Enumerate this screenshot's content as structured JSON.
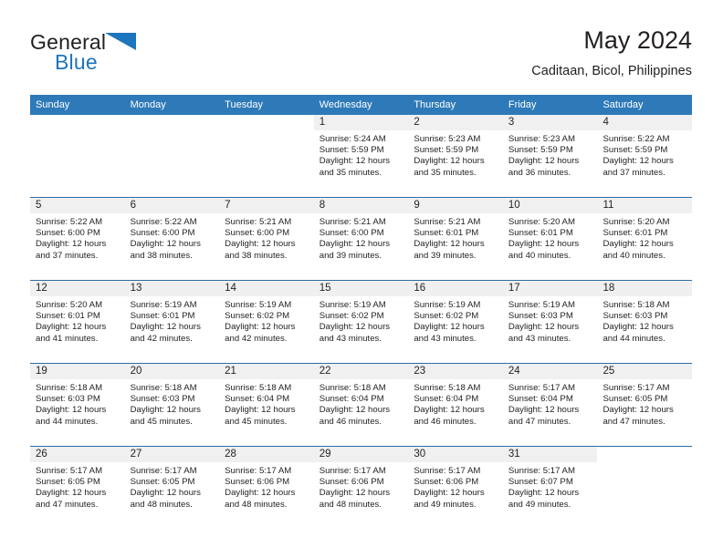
{
  "brand": {
    "name_part1": "General",
    "name_part2": "Blue",
    "accent_color": "#1d75bd"
  },
  "header": {
    "title": "May 2024",
    "subtitle": "Caditaan, Bicol, Philippines"
  },
  "calendar": {
    "header_color": "#2e7ab8",
    "weekdays": [
      "Sunday",
      "Monday",
      "Tuesday",
      "Wednesday",
      "Thursday",
      "Friday",
      "Saturday"
    ],
    "weeks": [
      [
        {
          "day": "",
          "sunrise": "",
          "sunset": "",
          "daylight": "",
          "daylight2": ""
        },
        {
          "day": "",
          "sunrise": "",
          "sunset": "",
          "daylight": "",
          "daylight2": ""
        },
        {
          "day": "",
          "sunrise": "",
          "sunset": "",
          "daylight": "",
          "daylight2": ""
        },
        {
          "day": "1",
          "sunrise": "Sunrise: 5:24 AM",
          "sunset": "Sunset: 5:59 PM",
          "daylight": "Daylight: 12 hours",
          "daylight2": "and 35 minutes."
        },
        {
          "day": "2",
          "sunrise": "Sunrise: 5:23 AM",
          "sunset": "Sunset: 5:59 PM",
          "daylight": "Daylight: 12 hours",
          "daylight2": "and 35 minutes."
        },
        {
          "day": "3",
          "sunrise": "Sunrise: 5:23 AM",
          "sunset": "Sunset: 5:59 PM",
          "daylight": "Daylight: 12 hours",
          "daylight2": "and 36 minutes."
        },
        {
          "day": "4",
          "sunrise": "Sunrise: 5:22 AM",
          "sunset": "Sunset: 5:59 PM",
          "daylight": "Daylight: 12 hours",
          "daylight2": "and 37 minutes."
        }
      ],
      [
        {
          "day": "5",
          "sunrise": "Sunrise: 5:22 AM",
          "sunset": "Sunset: 6:00 PM",
          "daylight": "Daylight: 12 hours",
          "daylight2": "and 37 minutes."
        },
        {
          "day": "6",
          "sunrise": "Sunrise: 5:22 AM",
          "sunset": "Sunset: 6:00 PM",
          "daylight": "Daylight: 12 hours",
          "daylight2": "and 38 minutes."
        },
        {
          "day": "7",
          "sunrise": "Sunrise: 5:21 AM",
          "sunset": "Sunset: 6:00 PM",
          "daylight": "Daylight: 12 hours",
          "daylight2": "and 38 minutes."
        },
        {
          "day": "8",
          "sunrise": "Sunrise: 5:21 AM",
          "sunset": "Sunset: 6:00 PM",
          "daylight": "Daylight: 12 hours",
          "daylight2": "and 39 minutes."
        },
        {
          "day": "9",
          "sunrise": "Sunrise: 5:21 AM",
          "sunset": "Sunset: 6:01 PM",
          "daylight": "Daylight: 12 hours",
          "daylight2": "and 39 minutes."
        },
        {
          "day": "10",
          "sunrise": "Sunrise: 5:20 AM",
          "sunset": "Sunset: 6:01 PM",
          "daylight": "Daylight: 12 hours",
          "daylight2": "and 40 minutes."
        },
        {
          "day": "11",
          "sunrise": "Sunrise: 5:20 AM",
          "sunset": "Sunset: 6:01 PM",
          "daylight": "Daylight: 12 hours",
          "daylight2": "and 40 minutes."
        }
      ],
      [
        {
          "day": "12",
          "sunrise": "Sunrise: 5:20 AM",
          "sunset": "Sunset: 6:01 PM",
          "daylight": "Daylight: 12 hours",
          "daylight2": "and 41 minutes."
        },
        {
          "day": "13",
          "sunrise": "Sunrise: 5:19 AM",
          "sunset": "Sunset: 6:01 PM",
          "daylight": "Daylight: 12 hours",
          "daylight2": "and 42 minutes."
        },
        {
          "day": "14",
          "sunrise": "Sunrise: 5:19 AM",
          "sunset": "Sunset: 6:02 PM",
          "daylight": "Daylight: 12 hours",
          "daylight2": "and 42 minutes."
        },
        {
          "day": "15",
          "sunrise": "Sunrise: 5:19 AM",
          "sunset": "Sunset: 6:02 PM",
          "daylight": "Daylight: 12 hours",
          "daylight2": "and 43 minutes."
        },
        {
          "day": "16",
          "sunrise": "Sunrise: 5:19 AM",
          "sunset": "Sunset: 6:02 PM",
          "daylight": "Daylight: 12 hours",
          "daylight2": "and 43 minutes."
        },
        {
          "day": "17",
          "sunrise": "Sunrise: 5:19 AM",
          "sunset": "Sunset: 6:03 PM",
          "daylight": "Daylight: 12 hours",
          "daylight2": "and 43 minutes."
        },
        {
          "day": "18",
          "sunrise": "Sunrise: 5:18 AM",
          "sunset": "Sunset: 6:03 PM",
          "daylight": "Daylight: 12 hours",
          "daylight2": "and 44 minutes."
        }
      ],
      [
        {
          "day": "19",
          "sunrise": "Sunrise: 5:18 AM",
          "sunset": "Sunset: 6:03 PM",
          "daylight": "Daylight: 12 hours",
          "daylight2": "and 44 minutes."
        },
        {
          "day": "20",
          "sunrise": "Sunrise: 5:18 AM",
          "sunset": "Sunset: 6:03 PM",
          "daylight": "Daylight: 12 hours",
          "daylight2": "and 45 minutes."
        },
        {
          "day": "21",
          "sunrise": "Sunrise: 5:18 AM",
          "sunset": "Sunset: 6:04 PM",
          "daylight": "Daylight: 12 hours",
          "daylight2": "and 45 minutes."
        },
        {
          "day": "22",
          "sunrise": "Sunrise: 5:18 AM",
          "sunset": "Sunset: 6:04 PM",
          "daylight": "Daylight: 12 hours",
          "daylight2": "and 46 minutes."
        },
        {
          "day": "23",
          "sunrise": "Sunrise: 5:18 AM",
          "sunset": "Sunset: 6:04 PM",
          "daylight": "Daylight: 12 hours",
          "daylight2": "and 46 minutes."
        },
        {
          "day": "24",
          "sunrise": "Sunrise: 5:17 AM",
          "sunset": "Sunset: 6:04 PM",
          "daylight": "Daylight: 12 hours",
          "daylight2": "and 47 minutes."
        },
        {
          "day": "25",
          "sunrise": "Sunrise: 5:17 AM",
          "sunset": "Sunset: 6:05 PM",
          "daylight": "Daylight: 12 hours",
          "daylight2": "and 47 minutes."
        }
      ],
      [
        {
          "day": "26",
          "sunrise": "Sunrise: 5:17 AM",
          "sunset": "Sunset: 6:05 PM",
          "daylight": "Daylight: 12 hours",
          "daylight2": "and 47 minutes."
        },
        {
          "day": "27",
          "sunrise": "Sunrise: 5:17 AM",
          "sunset": "Sunset: 6:05 PM",
          "daylight": "Daylight: 12 hours",
          "daylight2": "and 48 minutes."
        },
        {
          "day": "28",
          "sunrise": "Sunrise: 5:17 AM",
          "sunset": "Sunset: 6:06 PM",
          "daylight": "Daylight: 12 hours",
          "daylight2": "and 48 minutes."
        },
        {
          "day": "29",
          "sunrise": "Sunrise: 5:17 AM",
          "sunset": "Sunset: 6:06 PM",
          "daylight": "Daylight: 12 hours",
          "daylight2": "and 48 minutes."
        },
        {
          "day": "30",
          "sunrise": "Sunrise: 5:17 AM",
          "sunset": "Sunset: 6:06 PM",
          "daylight": "Daylight: 12 hours",
          "daylight2": "and 49 minutes."
        },
        {
          "day": "31",
          "sunrise": "Sunrise: 5:17 AM",
          "sunset": "Sunset: 6:07 PM",
          "daylight": "Daylight: 12 hours",
          "daylight2": "and 49 minutes."
        },
        {
          "day": "",
          "sunrise": "",
          "sunset": "",
          "daylight": "",
          "daylight2": ""
        }
      ]
    ]
  }
}
